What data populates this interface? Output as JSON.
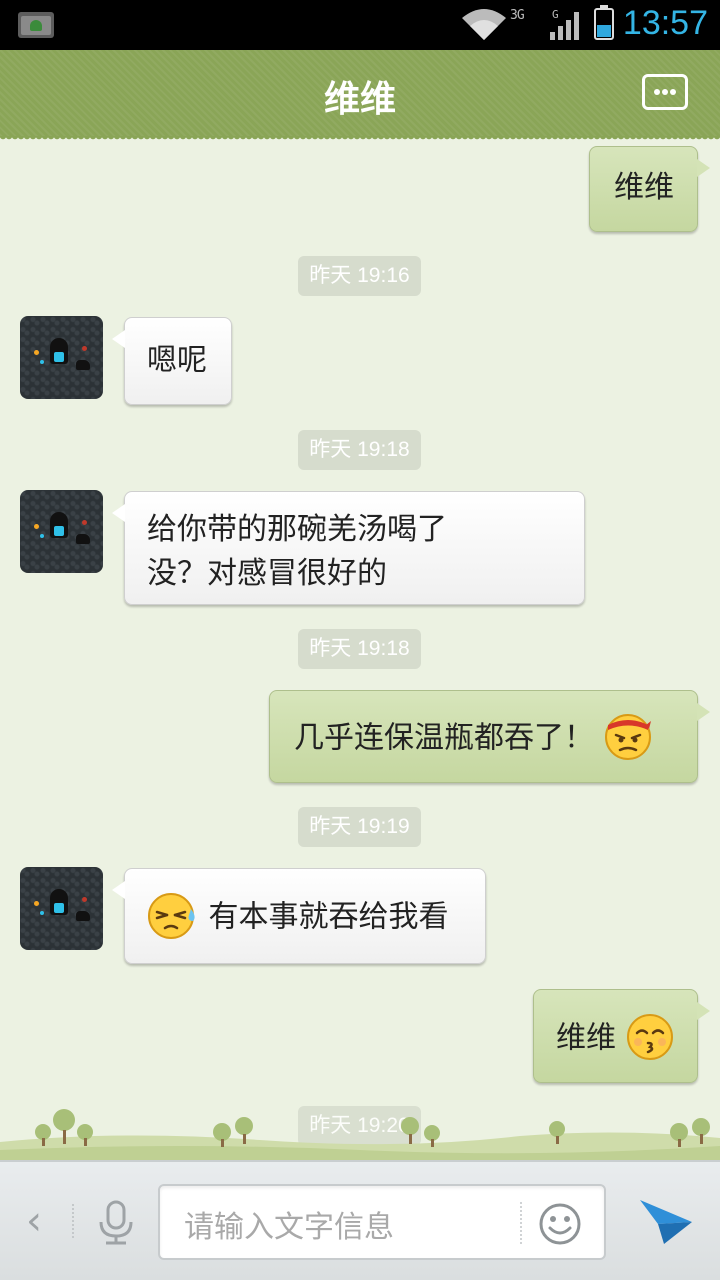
{
  "status_bar": {
    "network": "3G",
    "network2": "G",
    "time": "13:57"
  },
  "header": {
    "title": "维维"
  },
  "messages": [
    {
      "type": "out",
      "text": "维维"
    },
    {
      "type": "time",
      "text": "昨天 19:16"
    },
    {
      "type": "in",
      "text": "嗯呢"
    },
    {
      "type": "time",
      "text": "昨天 19:18"
    },
    {
      "type": "in",
      "text_line1": "给你带的那碗羌汤喝了",
      "text_line2": "没？对感冒很好的"
    },
    {
      "type": "time",
      "text": "昨天 19:18"
    },
    {
      "type": "out",
      "text": "几乎连保温瓶都吞了！",
      "emoji": "angry-headband-emoji"
    },
    {
      "type": "time",
      "text": "昨天 19:19"
    },
    {
      "type": "in",
      "text": "有本事就吞给我看",
      "emoji": "sweat-emoji"
    },
    {
      "type": "out",
      "text": "维维",
      "emoji": "kiss-emoji"
    },
    {
      "type": "time",
      "text": "昨天 19:20"
    }
  ],
  "input_bar": {
    "placeholder": "请输入文字信息",
    "back": "‹"
  },
  "colors": {
    "header": "#8aa557",
    "background": "#ecf2e2",
    "outgoing_bubble": "#cfdfae",
    "incoming_bubble": "#ffffff",
    "time_badge": "#d6dccd",
    "clock": "#34b5e5",
    "send": "#2f8fd8"
  }
}
